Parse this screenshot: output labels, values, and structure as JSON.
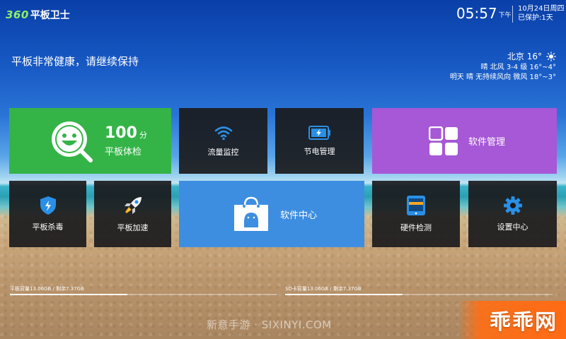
{
  "header": {
    "logo_number": "360",
    "logo_text": "平板卫士",
    "time": "05:57",
    "ampm": "下午",
    "date": "10月24日周四",
    "protected": "已保护:1天"
  },
  "status": {
    "health_message": "平板非常健康，请继续保持"
  },
  "weather": {
    "city_temp": "北京 16°",
    "today": "晴 北风 3-4 级 16°~4°",
    "tomorrow": "明天 晴 无持续风向 微风 18°~3°"
  },
  "tiles": {
    "checkup": {
      "score": "100",
      "unit": "分",
      "label": "平板体检"
    },
    "traffic": {
      "label": "流量监控"
    },
    "power": {
      "label": "节电管理"
    },
    "software": {
      "label": "软件管理"
    },
    "virus": {
      "label": "平板杀毒"
    },
    "speed": {
      "label": "平板加速"
    },
    "center": {
      "label": "软件中心"
    },
    "hardware": {
      "label": "硬件检测"
    },
    "settings": {
      "label": "设置中心"
    }
  },
  "storage": {
    "tablet": {
      "text": "平板容量13.06GB / 剩余7.37GB",
      "used_fraction": 0.44
    },
    "sd": {
      "text": "SD卡容量13.06GB / 剩余7.37GB",
      "used_fraction": 0.44
    }
  },
  "watermark": "新意手游 · SIXINYI.COM",
  "brand": "乖乖网",
  "colors": {
    "checkup_tile": "#34b447",
    "software_tile": "#a658d6",
    "center_tile": "#3d8ee0",
    "dark_tile": "#1a1a1c",
    "accent_blue": "#2a8fe6",
    "logo_green": "#8ef06a"
  },
  "icons": {
    "checkup": "smiley-magnifier-icon",
    "traffic": "wifi-icon",
    "power": "battery-icon",
    "software": "app-grid-icon",
    "virus": "shield-icon",
    "speed": "rocket-icon",
    "center": "shopping-bag-android-icon",
    "hardware": "tablet-icon",
    "settings": "gear-icon",
    "weather": "sun-icon"
  }
}
